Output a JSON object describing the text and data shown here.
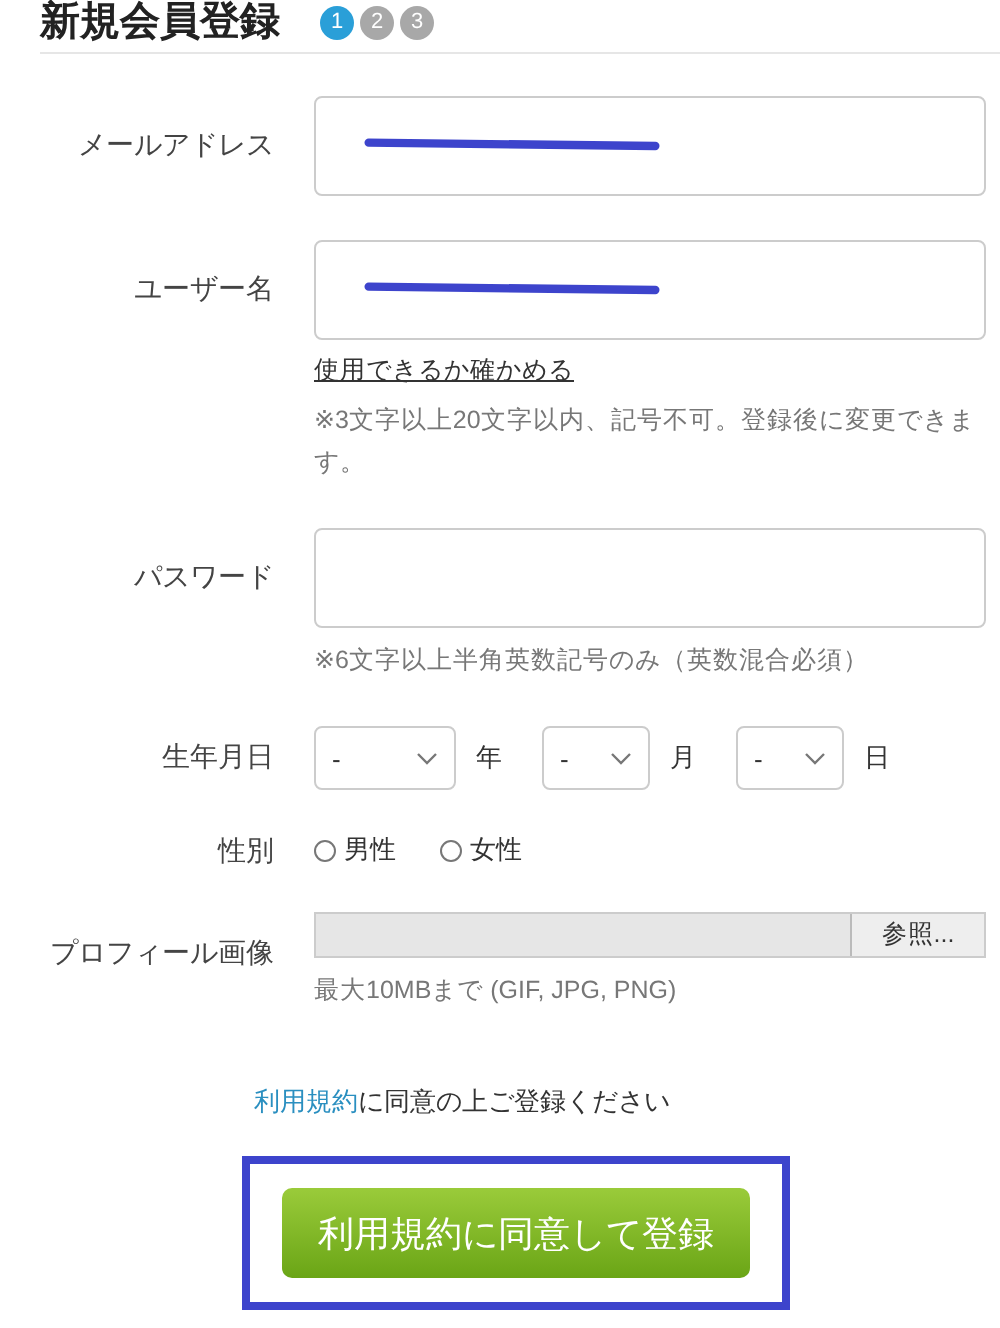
{
  "title": "新規会員登録",
  "steps": [
    {
      "label": "1",
      "selected": true
    },
    {
      "label": "2",
      "selected": false
    },
    {
      "label": "3",
      "selected": false
    }
  ],
  "fields": [
    {
      "kind": "text",
      "label": "メールアドレス",
      "redacted": true
    },
    {
      "kind": "text",
      "label": "ユーザー名",
      "redacted": true,
      "link": "使用できるか確かめる",
      "note": "※3文字以上20文字以内、記号不可。登録後に変更できます。"
    },
    {
      "kind": "text",
      "label": "パスワード",
      "redacted": false,
      "note": "※6文字以上半角英数記号のみ（英数混合必須）"
    },
    {
      "kind": "date",
      "label": "生年月日",
      "selects": [
        {
          "value": "-",
          "unit": "年"
        },
        {
          "value": "-",
          "unit": "月"
        },
        {
          "value": "-",
          "unit": "日"
        }
      ]
    },
    {
      "kind": "radio",
      "label": "性別",
      "options": [
        {
          "label": "男性",
          "selected": false
        },
        {
          "label": "女性",
          "selected": false
        }
      ]
    },
    {
      "kind": "file",
      "label": "プロフィール画像",
      "button": "参照...",
      "note": "最大10MBまで (GIF, JPG, PNG)"
    }
  ],
  "agreement": {
    "link": "利用規約",
    "text": "に同意の上ご登録ください"
  },
  "submit": {
    "label": "利用規約に同意して登録",
    "highlighted": true
  }
}
